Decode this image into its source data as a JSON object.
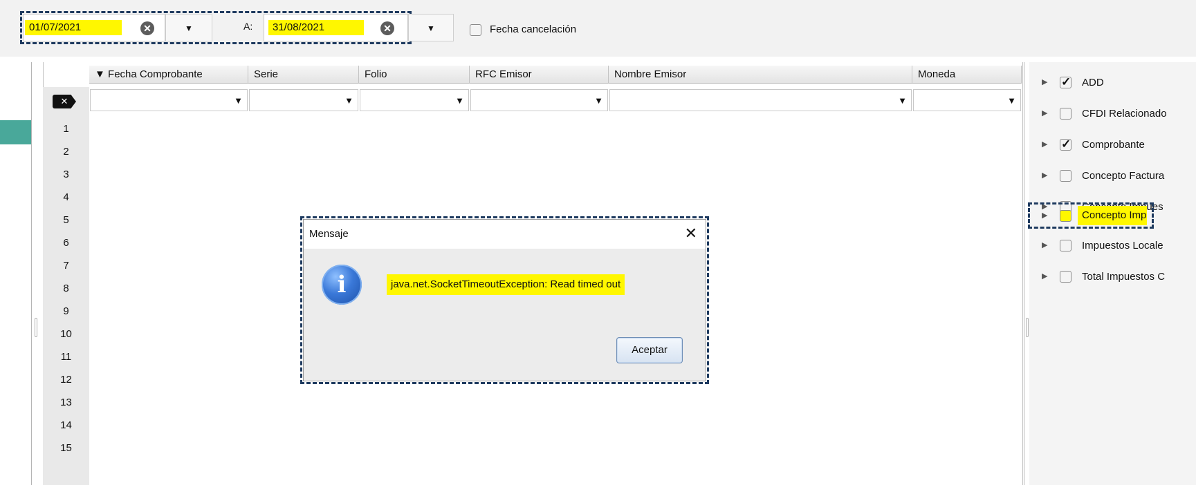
{
  "date_filter": {
    "from_value": "01/07/2021",
    "to_label": "A:",
    "to_value": "31/08/2021",
    "cancel_date_label": "Fecha cancelación",
    "cancel_date_checked": false
  },
  "grid": {
    "sort_indicator": "▼",
    "columns": [
      "Fecha Comprobante",
      "Serie",
      "Folio",
      "RFC Emisor",
      "Nombre Emisor",
      "Moneda"
    ],
    "row_numbers": [
      "1",
      "2",
      "3",
      "4",
      "5",
      "6",
      "7",
      "8",
      "9",
      "10",
      "11",
      "12",
      "13",
      "14",
      "15"
    ],
    "clear_filter_symbol": "✕"
  },
  "right_panel": {
    "items": [
      {
        "label": "ADD",
        "checked": true
      },
      {
        "label": "CFDI Relacionado",
        "checked": false
      },
      {
        "label": "Comprobante",
        "checked": true
      },
      {
        "label": "Concepto Factura",
        "checked": false
      },
      {
        "label": "Concepto Impues",
        "checked": false
      },
      {
        "label": "Concepto Impues",
        "checked": false,
        "highlighted": true
      },
      {
        "label": "Impuestos Locale",
        "checked": false
      },
      {
        "label": "Total Impuestos C",
        "checked": false
      }
    ]
  },
  "dialog": {
    "title": "Mensaje",
    "close_symbol": "✕",
    "icon": "info-icon",
    "icon_glyph": "i",
    "message": "java.net.SocketTimeoutException: Read timed out",
    "ok_label": "Aceptar"
  },
  "colors": {
    "highlight": "#fff700",
    "dashed_outline": "#1e3a5f",
    "teal_tab": "#49a89a"
  }
}
